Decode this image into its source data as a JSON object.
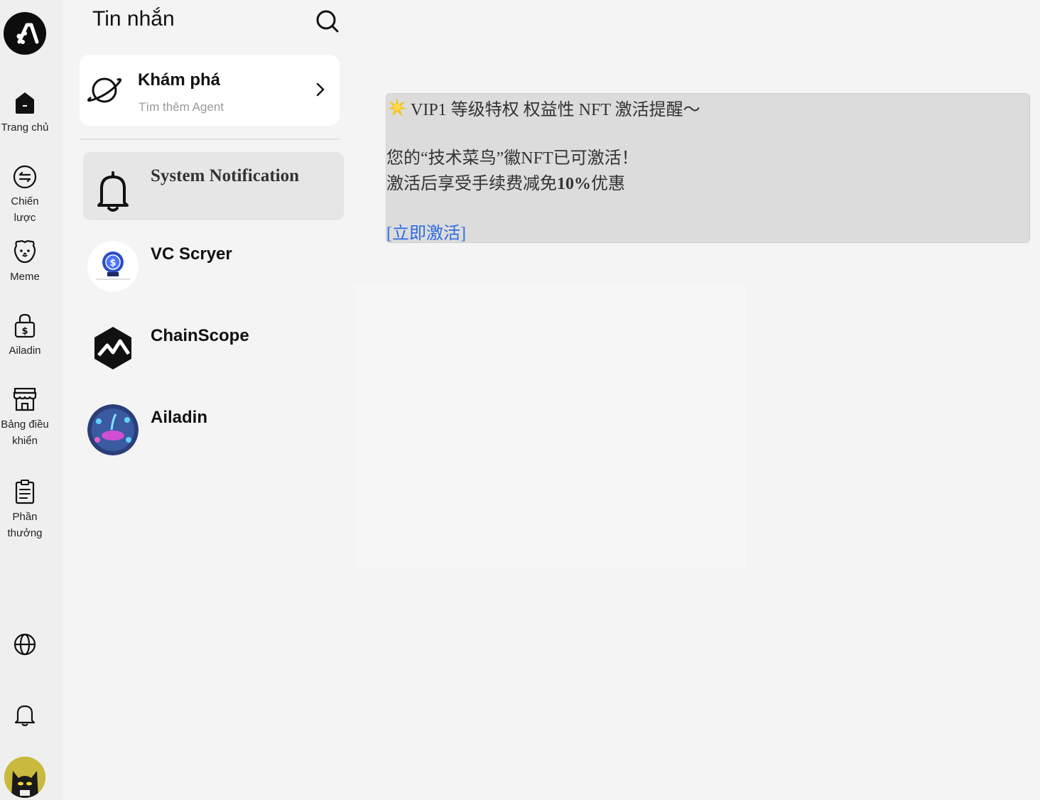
{
  "sidebar": {
    "items": [
      {
        "label": "Trang chủ",
        "icon": "home-icon"
      },
      {
        "label": "Chiến lược",
        "icon": "swap-circle-icon"
      },
      {
        "label": "Meme",
        "icon": "dog-face-icon"
      },
      {
        "label": "Ailadin",
        "icon": "lock-dollar-icon"
      },
      {
        "label": "Bảng điều khiển",
        "icon": "store-icon"
      },
      {
        "label": "Phần thưởng",
        "icon": "clipboard-icon"
      }
    ],
    "bottom": {
      "language_icon": "globe-icon",
      "notification_icon": "bell-icon",
      "avatar": "cat-avatar"
    }
  },
  "messages_panel": {
    "title": "Tin nhắn",
    "search_icon": "search-icon",
    "explore": {
      "title": "Khám phá",
      "subtitle": "Tìm thêm Agent",
      "icon": "planet-icon"
    },
    "conversations": [
      {
        "name": "System Notification",
        "icon": "bell-icon",
        "active": true
      },
      {
        "name": "VC Scryer",
        "icon": "vc-scryer-avatar",
        "active": false
      },
      {
        "name": "ChainScope",
        "icon": "chainscope-logo",
        "active": false
      },
      {
        "name": "Ailadin",
        "icon": "ailadin-avatar",
        "active": false
      }
    ]
  },
  "chat": {
    "message": {
      "title": "VIP1 等级特权 权益性 NFT 激活提醒～",
      "line1": "您的“技术菜鸟”徽NFT已可激活！",
      "line2_prefix": "激活后享受手续费减免",
      "line2_bold": "10%",
      "line2_suffix": "优惠",
      "link": "[立即激活]"
    },
    "colors": {
      "bubble": "#dcdcdc",
      "link": "#2f6ae0"
    }
  }
}
